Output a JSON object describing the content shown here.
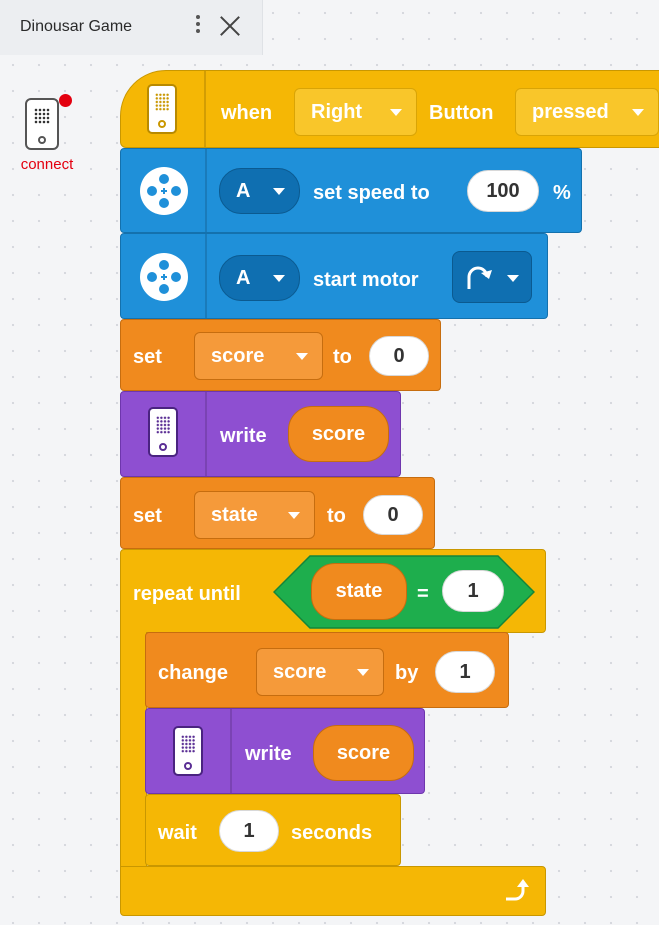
{
  "tab": {
    "title": "Dinousar Game"
  },
  "hub": {
    "label": "connect"
  },
  "program": {
    "when": {
      "when_label": "when",
      "button": "Right",
      "button_label": "Button",
      "state": "pressed"
    },
    "set_speed": {
      "port": "A",
      "label": "set speed to",
      "value": "100",
      "unit": "%"
    },
    "start_motor": {
      "port": "A",
      "label": "start motor",
      "direction_icon": "clockwise-icon"
    },
    "set_score": {
      "set_label": "set",
      "variable": "score",
      "to_label": "to",
      "value": "0"
    },
    "write1": {
      "label": "write",
      "variable": "score"
    },
    "set_state": {
      "set_label": "set",
      "variable": "state",
      "to_label": "to",
      "value": "0"
    },
    "repeat": {
      "label": "repeat until",
      "condition": {
        "variable": "state",
        "operator": "=",
        "value": "1"
      },
      "change": {
        "label": "change",
        "variable": "score",
        "by_label": "by",
        "value": "1"
      },
      "write": {
        "label": "write",
        "variable": "score"
      },
      "wait": {
        "label": "wait",
        "value": "1",
        "unit": "seconds"
      },
      "loop_icon": "loop-arrow-icon"
    }
  },
  "colors": {
    "events": "#f5b705",
    "motors": "#1f90d9",
    "variables": "#f08a1e",
    "display": "#8e4fd1",
    "control": "#f5b705",
    "operators": "#1eae4d",
    "hub_status": "#e3000f"
  }
}
